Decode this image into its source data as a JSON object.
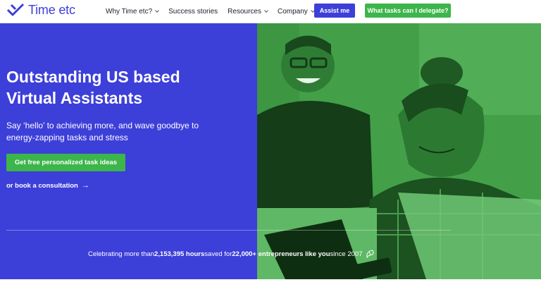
{
  "brand": {
    "name": "Time etc"
  },
  "nav": {
    "items": [
      {
        "label": "Why Time etc?",
        "has_dropdown": true
      },
      {
        "label": "Success stories",
        "has_dropdown": false
      },
      {
        "label": "Resources",
        "has_dropdown": true
      },
      {
        "label": "Company",
        "has_dropdown": true
      }
    ],
    "assist_button": "Assist me",
    "delegate_button": "What tasks can I delegate?"
  },
  "hero": {
    "headline_line1": "Outstanding US based",
    "headline_line2": "Virtual Assistants",
    "subtext": "Say ‘hello’ to achieving more, and wave goodbye to energy-zapping tasks and stress",
    "cta_button": "Get free personalized task ideas",
    "consult_link": "or book a consultation",
    "arrow": "→"
  },
  "stats": {
    "prefix": "Celebrating more than ",
    "hours": "2,153,395 hours",
    "middle": " saved for ",
    "entrepreneurs": "22,000+ entrepreneurs like you",
    "suffix": " since 2007"
  },
  "colors": {
    "brand_blue": "#3d3fd9",
    "brand_green": "#3cb54a",
    "photo_green": "#3f9d45"
  },
  "icons": {
    "logo": "checkmark-logo-icon",
    "arrow": "arrow-right-icon",
    "spark": "sparkle-doodle-icon"
  }
}
